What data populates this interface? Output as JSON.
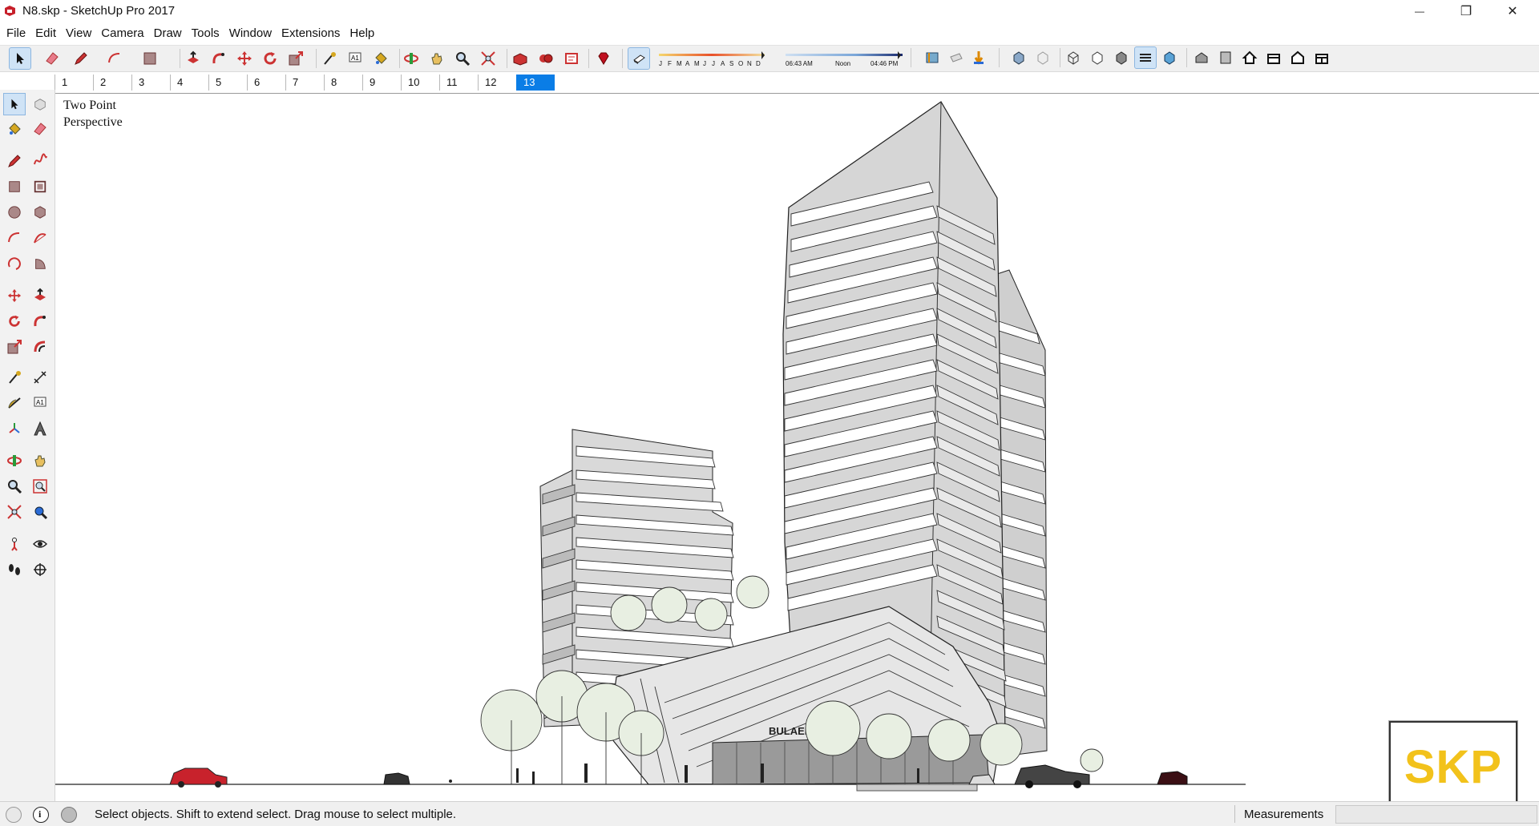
{
  "window": {
    "title": "N8.skp - SketchUp Pro 2017",
    "minimize_glyph": "—",
    "restore_glyph": "❐",
    "close_glyph": "✕"
  },
  "menu": [
    "File",
    "Edit",
    "View",
    "Camera",
    "Draw",
    "Tools",
    "Window",
    "Extensions",
    "Help"
  ],
  "shadow": {
    "months": [
      "J",
      "F",
      "M",
      "A",
      "M",
      "J",
      "J",
      "A",
      "S",
      "O",
      "N",
      "D"
    ],
    "time_start": "06:43 AM",
    "time_noon": "Noon",
    "time_end": "04:46 PM"
  },
  "scenes": [
    "1",
    "2",
    "3",
    "4",
    "5",
    "6",
    "7",
    "8",
    "9",
    "10",
    "11",
    "12",
    "13"
  ],
  "selected_scene": "13",
  "viewport": {
    "label_line1": "Two Point",
    "label_line2": "Perspective",
    "sign_text": "BULAERA"
  },
  "logo": {
    "text": "SKP"
  },
  "status": {
    "message": "Select objects. Shift to extend select. Drag mouse to select multiple.",
    "measurements_label": "Measurements",
    "measurements_value": ""
  },
  "colors": {
    "accent_selected": "#0a7de6",
    "logo_yellow": "#f2c21b",
    "logo_underline": "#3a1d6e",
    "app_red": "#c7202a"
  },
  "icons": {
    "toolbar": [
      "select-icon",
      "eraser-icon",
      "pencil-icon",
      "arc-icon",
      "shape-icon",
      "push-pull-icon",
      "follow-me-icon",
      "move-icon",
      "rotate-icon",
      "scale-icon",
      "tape-measure-icon",
      "text-icon",
      "paint-bucket-icon",
      "orbit-icon",
      "pan-icon",
      "zoom-icon",
      "zoom-extents-icon",
      "warehouse-icon",
      "extension-warehouse-icon",
      "layout-icon",
      "ruby-icon",
      "shadow-toggle-icon",
      "section-plane-icon",
      "section-display-icon",
      "section-cut-icon",
      "xray-icon",
      "back-edges-icon",
      "wireframe-icon",
      "hidden-line-icon",
      "shaded-icon",
      "shaded-textures-icon",
      "monochrome-icon",
      "iso-view-icon",
      "top-view-icon",
      "front-view-icon",
      "right-view-icon",
      "back-view-icon",
      "left-view-icon"
    ],
    "left": [
      "select-icon",
      "component-icon",
      "paint-bucket-icon",
      "eraser-icon",
      "line-icon",
      "freehand-icon",
      "rectangle-icon",
      "rotated-rectangle-icon",
      "circle-icon",
      "polygon-icon",
      "arc-icon",
      "pie-icon",
      "two-point-arc-icon",
      "three-point-arc-icon",
      "move-icon",
      "push-pull-icon",
      "rotate-icon",
      "follow-me-icon",
      "scale-icon",
      "offset-icon",
      "tape-measure-icon",
      "dimension-icon",
      "protractor-icon",
      "text-icon",
      "axes-icon",
      "3d-text-icon",
      "orbit-icon",
      "pan-icon",
      "zoom-icon",
      "zoom-window-icon",
      "zoom-extents-icon",
      "previous-view-icon",
      "position-camera-icon",
      "look-around-icon",
      "walk-icon",
      "section-plane-icon"
    ]
  }
}
